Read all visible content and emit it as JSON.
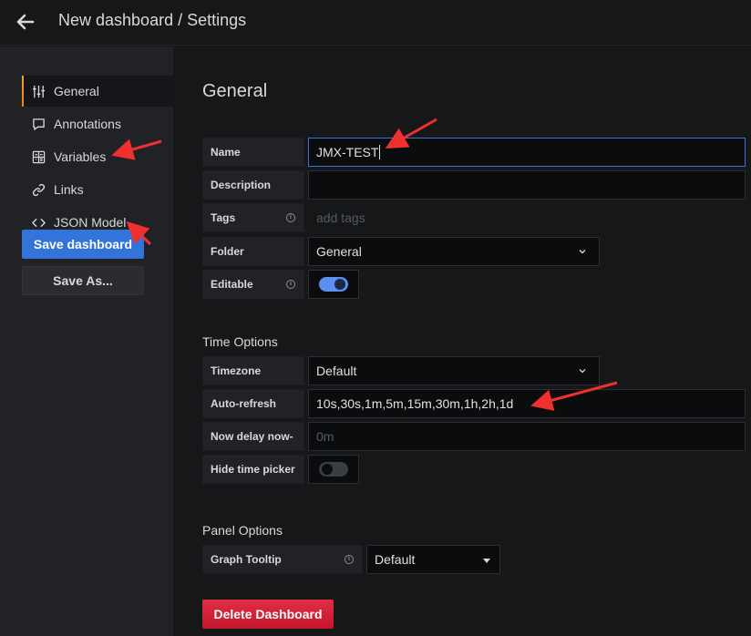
{
  "header": {
    "title": "New dashboard / Settings",
    "back_icon": "arrow-left-icon"
  },
  "sidebar": {
    "items": [
      {
        "label": "General",
        "icon": "sliders-icon",
        "active": true
      },
      {
        "label": "Annotations",
        "icon": "comment-icon",
        "active": false
      },
      {
        "label": "Variables",
        "icon": "calculator-icon",
        "active": false
      },
      {
        "label": "Links",
        "icon": "link-icon",
        "active": false
      },
      {
        "label": "JSON Model",
        "icon": "code-icon",
        "active": false
      }
    ],
    "save_label": "Save dashboard",
    "save_as_label": "Save As..."
  },
  "general": {
    "title": "General",
    "name_label": "Name",
    "name_value": "JMX-TEST",
    "description_label": "Description",
    "description_value": "",
    "tags_label": "Tags",
    "tags_placeholder": "add tags",
    "folder_label": "Folder",
    "folder_value": "General",
    "editable_label": "Editable",
    "editable_on": true
  },
  "time_options": {
    "title": "Time Options",
    "timezone_label": "Timezone",
    "timezone_value": "Default",
    "autorefresh_label": "Auto-refresh",
    "autorefresh_value": "10s,30s,1m,5m,15m,30m,1h,2h,1d",
    "nowdelay_label": "Now delay now-",
    "nowdelay_placeholder": "0m",
    "hidepicker_label": "Hide time picker",
    "hidepicker_on": false
  },
  "panel_options": {
    "title": "Panel Options",
    "tooltip_label": "Graph Tooltip",
    "tooltip_value": "Default"
  },
  "delete_label": "Delete Dashboard",
  "colors": {
    "primary": "#3274d9",
    "danger": "#e02f44",
    "active_accent": "#f5a623",
    "annotation_arrow": "#f0302e"
  }
}
